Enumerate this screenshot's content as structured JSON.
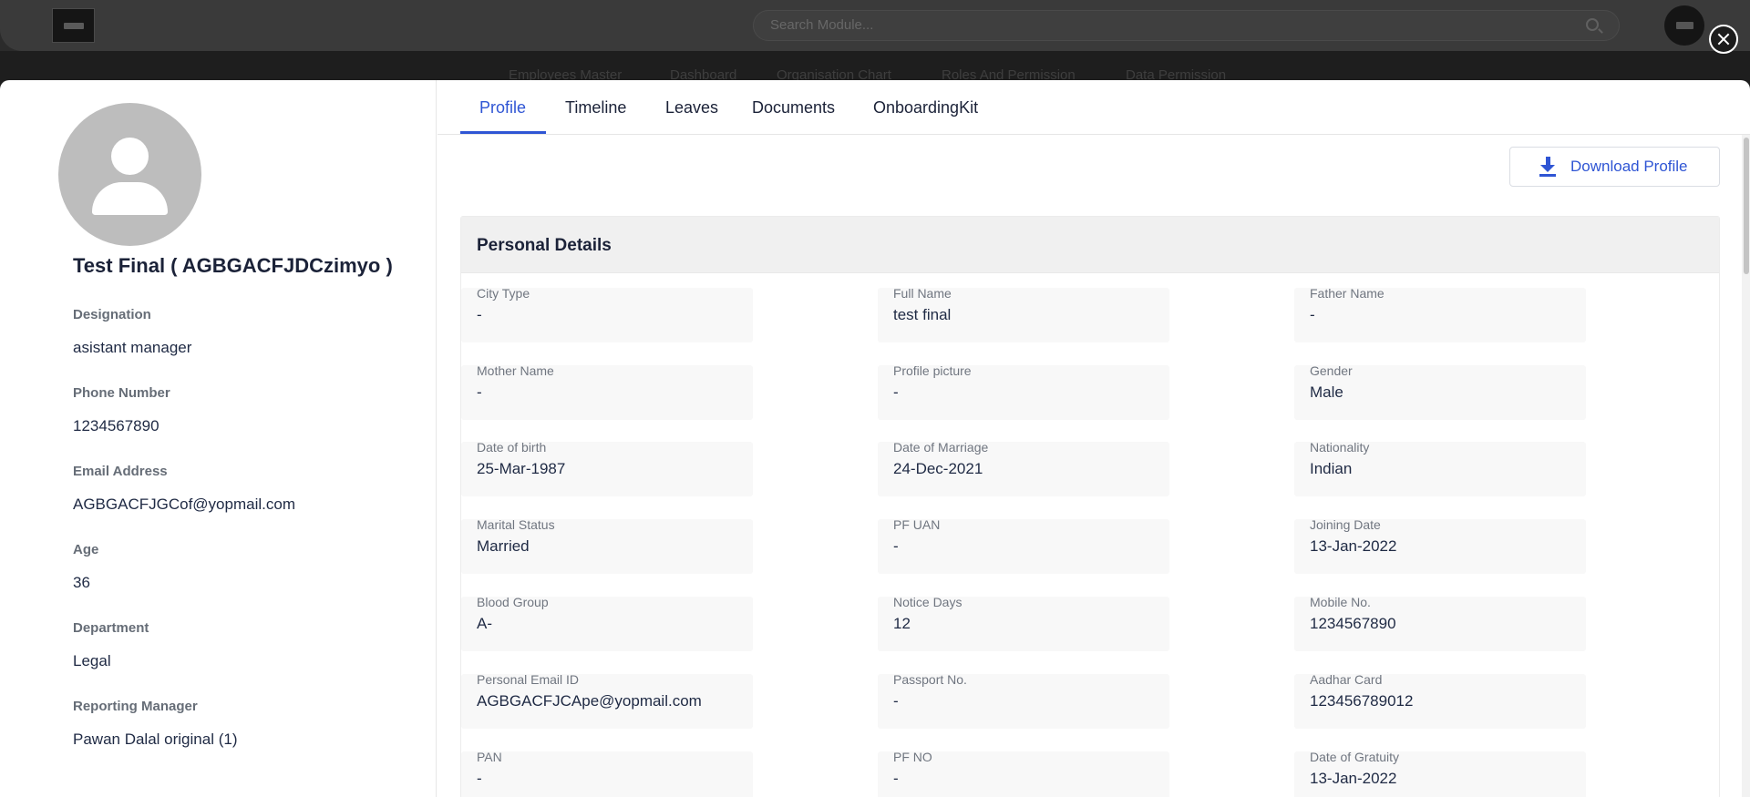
{
  "background": {
    "search_placeholder": "Search Module...",
    "nav_items": [
      "Employees Master",
      "Dashboard",
      "Organisation Chart",
      "Roles And Permission",
      "Data Permission"
    ]
  },
  "profile": {
    "name": "Test Final ( AGBGACFJDCzimyo )",
    "details": [
      {
        "label": "Designation",
        "value": "asistant manager"
      },
      {
        "label": "Phone Number",
        "value": "1234567890"
      },
      {
        "label": "Email Address",
        "value": "AGBGACFJGCof@yopmail.com"
      },
      {
        "label": "Age",
        "value": "36"
      },
      {
        "label": "Department",
        "value": "Legal"
      },
      {
        "label": "Reporting Manager",
        "value": "Pawan Dalal original (1)"
      }
    ]
  },
  "tabs": [
    {
      "label": "Profile",
      "active": true
    },
    {
      "label": "Timeline",
      "active": false
    },
    {
      "label": "Leaves",
      "active": false
    },
    {
      "label": "Documents",
      "active": false
    },
    {
      "label": "OnboardingKit",
      "active": false
    }
  ],
  "download_button": {
    "label": "Download Profile"
  },
  "personal_details": {
    "title": "Personal Details",
    "fields": [
      {
        "label": "City Type",
        "value": "-"
      },
      {
        "label": "Full Name",
        "value": "test final"
      },
      {
        "label": "Father Name",
        "value": "-"
      },
      {
        "label": "Mother Name",
        "value": "-"
      },
      {
        "label": "Profile picture",
        "value": "-"
      },
      {
        "label": "Gender",
        "value": "Male"
      },
      {
        "label": "Date of birth",
        "value": "25-Mar-1987"
      },
      {
        "label": "Date of Marriage",
        "value": "24-Dec-2021"
      },
      {
        "label": "Nationality",
        "value": "Indian"
      },
      {
        "label": "Marital Status",
        "value": "Married"
      },
      {
        "label": "PF UAN",
        "value": "-"
      },
      {
        "label": "Joining Date",
        "value": "13-Jan-2022"
      },
      {
        "label": "Blood Group",
        "value": "A-"
      },
      {
        "label": "Notice Days",
        "value": "12"
      },
      {
        "label": "Mobile No.",
        "value": "1234567890"
      },
      {
        "label": "Personal Email ID",
        "value": "AGBGACFJCApe@yopmail.com"
      },
      {
        "label": "Passport No.",
        "value": "-"
      },
      {
        "label": "Aadhar Card",
        "value": "123456789012"
      },
      {
        "label": "PAN",
        "value": "-"
      },
      {
        "label": "PF NO",
        "value": "-"
      },
      {
        "label": "Date of Gratuity",
        "value": "13-Jan-2022"
      }
    ]
  },
  "colors": {
    "accent": "#2f55d4",
    "overlay": "#2b2b2b",
    "avatar_bg": "#bdbdbd",
    "section_header_bg": "#f0f0f0",
    "field_bg": "#f8f8f8"
  }
}
